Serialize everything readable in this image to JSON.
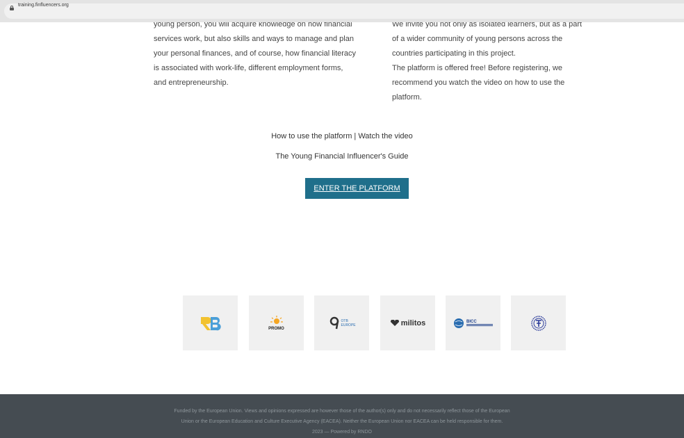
{
  "browser": {
    "url": "training.finfluencers.org"
  },
  "left_column": {
    "cut_line": "young person, you will acquire knowledge on how financial",
    "lines": [
      "services work, but also skills and ways to manage and plan",
      "your personal finances, and of course, how financial literacy",
      "is associated with work-life, different employment forms,",
      "and entrepreneurship."
    ]
  },
  "right_column": {
    "cut_line": "We invite you not only as isolated learners, but as a part",
    "lines": [
      "of a wider community of young persons across the",
      "countries participating in this project.",
      "The platform is offered free! Before registering, we",
      "recommend you watch the video on how to use the",
      "platform."
    ]
  },
  "links": {
    "video": "How to use the platform | Watch the video",
    "guide": "The Young Financial Influencer's Guide"
  },
  "cta": {
    "label": "ENTER THE PLATFORM"
  },
  "logos": [
    {
      "name": "rndo",
      "text": "R"
    },
    {
      "name": "promo",
      "text": "PROMO"
    },
    {
      "name": "otb-europe",
      "text": "OTB EUROPE"
    },
    {
      "name": "militos",
      "text": "militos"
    },
    {
      "name": "bicc",
      "text": "BICC"
    },
    {
      "name": "emblem",
      "text": ""
    }
  ],
  "footer": {
    "line1": "Funded by the European Union. Views and opinions expressed are however those of the author(s) only and do not necessarily reflect those of the European",
    "line2": "Union or the European Education and Culture Executive Agency (EACEA). Neither the European Union nor EACEA can be held responsible for them.",
    "line3": "2023 — Powered by RNDO"
  },
  "colors": {
    "button": "#1f6f8b",
    "footer": "#454c52"
  }
}
